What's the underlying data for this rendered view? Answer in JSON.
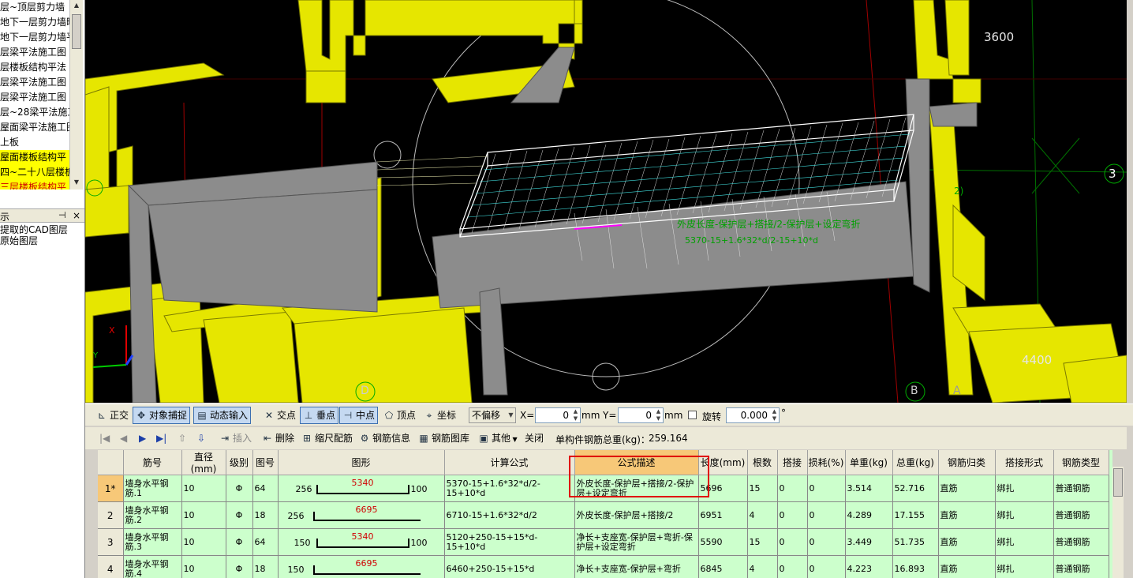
{
  "layer_panel": {
    "items": [
      "层~顶层剪力墙",
      "地下一层剪力墙暗",
      "地下一层剪力墙平",
      "层梁平法施工图",
      "层楼板结构平法",
      "层梁平法施工图",
      "层梁平法施工图",
      "层~28梁平法施工",
      "屋面梁平法施工图",
      "上板",
      "屋面楼板结构平",
      "四~二十八层楼板",
      "三层楼板结构平"
    ],
    "panel2_title": "示",
    "pin_icon": "pin-icon",
    "close_label": "×",
    "cad_options": [
      "提取的CAD图层",
      "原始图层"
    ]
  },
  "viewport": {
    "labels": {
      "dim_3600": "3600",
      "dim_4400": "4400",
      "axis_3": "3",
      "axis_b": "B",
      "axis_d": "D",
      "axis_2": "2)",
      "axis_a": "A"
    },
    "green_annotation_1": "外皮长度-保护层+搭接/2-保护层+设定弯折",
    "green_annotation_2": "5370-15+1.6*32*d/2-15+10*d",
    "axes": {
      "x": "X",
      "y": "Y",
      "z": "Z"
    }
  },
  "snap_toolbar": {
    "ortho": "正交",
    "object_snap": "对象捕捉",
    "dynamic_input": "动态输入",
    "intersection": "交点",
    "perpendicular": "垂点",
    "midpoint": "中点",
    "vertex": "顶点",
    "coordinate": "坐标",
    "offset_mode": "不偏移",
    "x_label": "X=",
    "x_value": "0",
    "y_label": "Y=",
    "y_value": "0",
    "unit": "mm",
    "rotate_label": "旋转",
    "rotate_value": "0.000",
    "degree": "°"
  },
  "rebar_toolbar": {
    "insert": "插入",
    "delete": "删除",
    "scale_rebar": "缩尺配筋",
    "rebar_info": "钢筋信息",
    "rebar_library": "钢筋图库",
    "other": "其他",
    "close": "关闭",
    "total_weight_label": "单构件钢筋总重(kg)：",
    "total_weight_value": "259.164"
  },
  "table": {
    "headers": [
      "筋号",
      "直径(mm)",
      "级别",
      "图号",
      "图形",
      "计算公式",
      "公式描述",
      "长度(mm)",
      "根数",
      "搭接",
      "损耗(%)",
      "单重(kg)",
      "总重(kg)",
      "钢筋归类",
      "搭接形式",
      "钢筋类型"
    ],
    "rows": [
      {
        "no": "1*",
        "name": "墙身水平钢筋.1",
        "dia": "10",
        "grade": "Φ",
        "fig": "64",
        "left": "256",
        "mid": "5340",
        "right": "100",
        "formula": "5370-15+1.6*32*d/2-15+10*d",
        "desc": "外皮长度-保护层+搭接/2-保护层+设定弯折",
        "length": "5696",
        "count": "15",
        "lap": "0",
        "loss": "0",
        "unit_w": "3.514",
        "total_w": "52.716",
        "category": "直筋",
        "lap_type": "绑扎",
        "type": "普通钢筋"
      },
      {
        "no": "2",
        "name": "墙身水平钢筋.2",
        "dia": "10",
        "grade": "Φ",
        "fig": "18",
        "left": "256",
        "mid": "6695",
        "right": "",
        "formula": "6710-15+1.6*32*d/2",
        "desc": "外皮长度-保护层+搭接/2",
        "length": "6951",
        "count": "4",
        "lap": "0",
        "loss": "0",
        "unit_w": "4.289",
        "total_w": "17.155",
        "category": "直筋",
        "lap_type": "绑扎",
        "type": "普通钢筋"
      },
      {
        "no": "3",
        "name": "墙身水平钢筋.3",
        "dia": "10",
        "grade": "Φ",
        "fig": "64",
        "left": "150",
        "mid": "5340",
        "right": "100",
        "formula": "5120+250-15+15*d-15+10*d",
        "desc": "净长+支座宽-保护层+弯折-保护层+设定弯折",
        "length": "5590",
        "count": "15",
        "lap": "0",
        "loss": "0",
        "unit_w": "3.449",
        "total_w": "51.735",
        "category": "直筋",
        "lap_type": "绑扎",
        "type": "普通钢筋"
      },
      {
        "no": "4",
        "name": "墙身水平钢筋.4",
        "dia": "10",
        "grade": "Φ",
        "fig": "18",
        "left": "150",
        "mid": "6695",
        "right": "",
        "formula": "6460+250-15+15*d",
        "desc": "净长+支座宽-保护层+弯折",
        "length": "6845",
        "count": "4",
        "lap": "0",
        "loss": "0",
        "unit_w": "4.223",
        "total_w": "16.893",
        "category": "直筋",
        "lap_type": "绑扎",
        "type": "普通钢筋"
      }
    ]
  },
  "colors": {
    "wall_yellow": "#e6e600",
    "wall_gray": "#9a9a9a",
    "table_green": "#ccffcc",
    "highlight_orange": "#f7c878",
    "red_box": "#e00000"
  }
}
